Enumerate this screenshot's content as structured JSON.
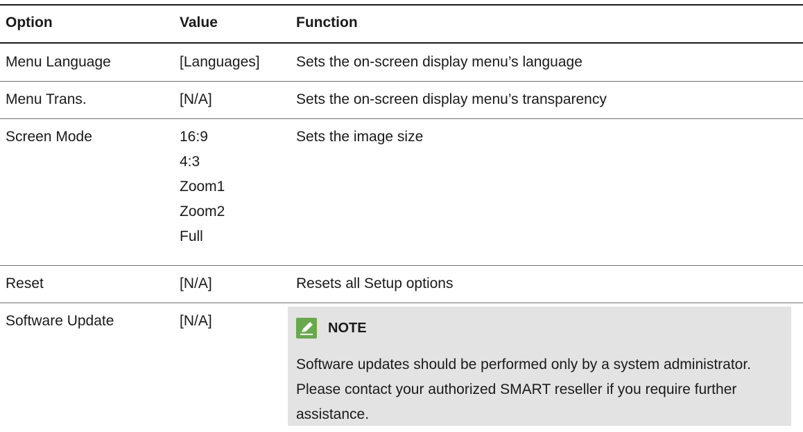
{
  "headers": {
    "option": "Option",
    "value": "Value",
    "function": "Function"
  },
  "rows": [
    {
      "option": "Menu Language",
      "value": "[Languages]",
      "function": "Sets the on-screen display menu’s language"
    },
    {
      "option": "Menu Trans.",
      "value": "[N/A]",
      "function": "Sets the on-screen display menu’s transparency"
    },
    {
      "option": "Screen Mode",
      "values": [
        "16:9",
        "4:3",
        "Zoom1",
        "Zoom2",
        "Full"
      ],
      "function": "Sets the image size"
    },
    {
      "option": "Reset",
      "value": "[N/A]",
      "function": "Resets all Setup options"
    },
    {
      "option": "Software Update",
      "value": "[N/A]"
    }
  ],
  "note": {
    "icon": "pencil-icon",
    "title": "NOTE",
    "body": "Software updates should be performed only by a system administrator. Please contact your authorized SMART reseller if you require further assistance."
  },
  "colors": {
    "rule": "#1a1a1a",
    "note_background": "#e3e3e3",
    "note_icon": "#6aa84f"
  }
}
